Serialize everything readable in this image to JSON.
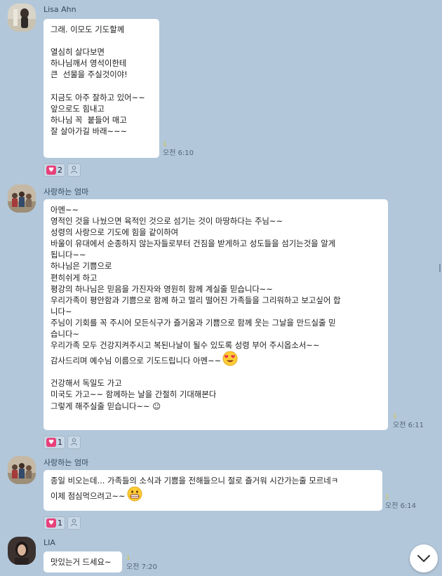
{
  "messages": [
    {
      "sender": "Lisa Ahn",
      "lines": [
        "그래. 이모도 기도할께",
        "",
        "열심히 살다보면",
        "하나님깨서 영석이한테",
        "큰  선물을 주실것이야!",
        "",
        "지금도 아주 잘하고 있어~~",
        "앞으로도 힘내고",
        "하나님 꼭  붙들어 매고",
        "잘 살아가길 바래~~~"
      ],
      "read": "1",
      "time": "오전 6:10",
      "heart_count": "2"
    },
    {
      "sender": "사랑하는 엄마",
      "lines": [
        "아멘~~",
        "영적인 것을 나눴으면 육적인 것으로 섬기는 것이 마땅하다는 주님~~",
        "성령의 사랑으로 기도에 힘을 같이하여",
        "바울이 유대에서 순종하지 않는자들로부터 건짐을 받게하고 성도들을 섬기는것을 알게",
        "됩니다~~",
        "하나님은 기쁨으로",
        "편히쉬게 하고",
        "평강의 하나님은 믿음을 가진자와 영원히 함께 계실줄 믿습니다~~",
        "우리가족이 평안함과 기쁨으로 함께 하고 멀리 떨어진 가족들을 그리워하고 보고싶어 합",
        "니다~",
        "주님이 기회를 꼭 주시어 모든식구가 즐거움과 기쁨으로 함께 웃는 그날을 만드실줄 믿",
        "습니다~",
        "우리가족 모두 건강지켜주시고 복된나날이 될수 있도록 성령 부어 주시옵소서~~",
        "감사드리며 예수님 이름으로 기도드립니다 아멘~~",
        "",
        "건강해서 독일도 가고",
        "미국도 가고~~ 함께하는 날을 간절히 기대해본다",
        "그렇게 해주실줄 믿습니다~~ ☺"
      ],
      "read": "1",
      "time": "오전 6:11",
      "heart_count": "1"
    },
    {
      "sender": "사랑하는 엄마",
      "lines": [
        "종일 비오는데... 가족들의 소식과 기쁨을 전해들으니 절로 즐거워 시간가는줄 모르네ㅋ",
        "이제 점심먹으려고~~"
      ],
      "read": "1",
      "time": "오전 6:14",
      "heart_count": "1"
    },
    {
      "sender": "LIA",
      "lines": [
        "맛있는거 드세요~"
      ],
      "read": "1",
      "time": "오전 7:20"
    }
  ],
  "icons": {
    "heart": "heart-icon",
    "person": "person-icon",
    "scroll": "chevron-down-icon"
  },
  "colors": {
    "chat_bg": "#b2c7da",
    "bubble": "#ffffff",
    "heart": "#e8407a",
    "read_marker": "#d8c43a"
  }
}
